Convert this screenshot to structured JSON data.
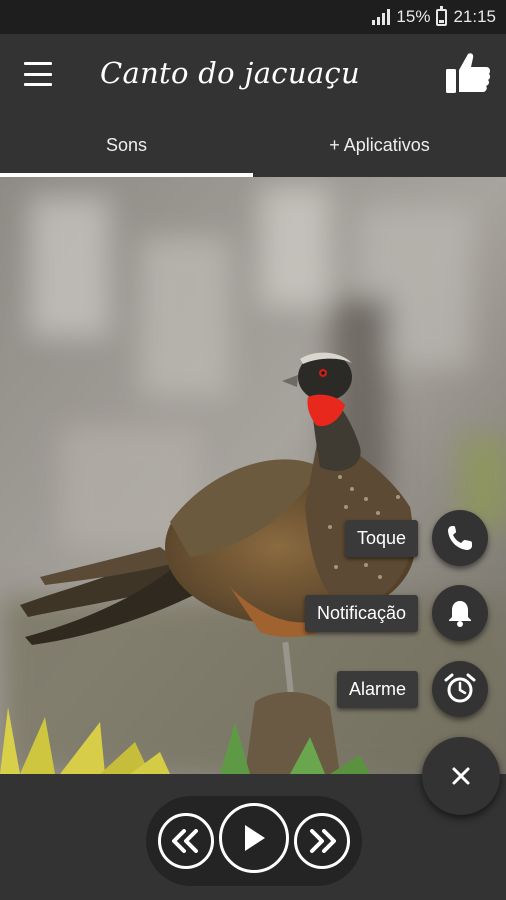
{
  "status_bar": {
    "battery": "15%",
    "time": "21:15"
  },
  "app_bar": {
    "title": "Canto do jacuaçu",
    "menu_icon": "menu-icon",
    "like_icon": "thumbs-up-icon"
  },
  "tabs": [
    {
      "label": "Sons",
      "active": true
    },
    {
      "label": "+ Aplicativos",
      "active": false
    }
  ],
  "actions": {
    "toque": {
      "label": "Toque",
      "icon": "phone-icon"
    },
    "notificacao": {
      "label": "Notificação",
      "icon": "bell-icon"
    },
    "alarme": {
      "label": "Alarme",
      "icon": "alarm-clock-icon"
    },
    "close_icon": "close-icon"
  },
  "player": {
    "rewind_icon": "rewind-icon",
    "play_icon": "play-icon",
    "forward_icon": "fast-forward-icon"
  },
  "colors": {
    "bar": "#333333",
    "status": "#1e1e1e",
    "accent": "#ffffff",
    "bird_throat": "#e8281c"
  }
}
